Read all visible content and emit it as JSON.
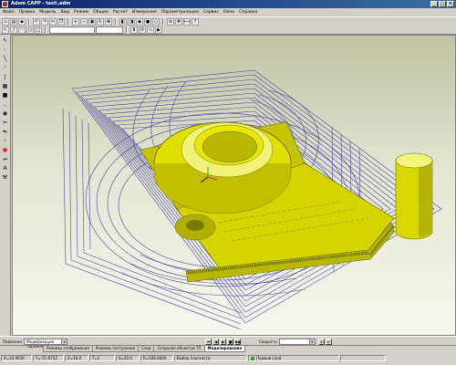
{
  "window": {
    "title": "Adem CAPP - test\\.adm"
  },
  "menu": [
    "Файл",
    "Правка",
    "Модель",
    "Вид",
    "Режим",
    "Общие",
    "Расчет",
    "Измерения",
    "Параметризация",
    "Сервис",
    "Окно",
    "Справка"
  ],
  "status": {
    "layers_label": "Переключ",
    "history_combo": "Модификация переменных",
    "speed_label": "Скорость",
    "tabs": [
      "Режимы отображения",
      "Режимы построения",
      "Слои",
      "Создание объектов ТП",
      "Моделирование"
    ],
    "active_tab": 4,
    "coords": [
      "X=35.9636",
      "Y=-51.6752",
      "Z=10.0",
      "T=1",
      "S=20.0",
      "R=500.0000"
    ],
    "selection_mode": "Выбор плоскости",
    "layer": "Первый слой"
  }
}
